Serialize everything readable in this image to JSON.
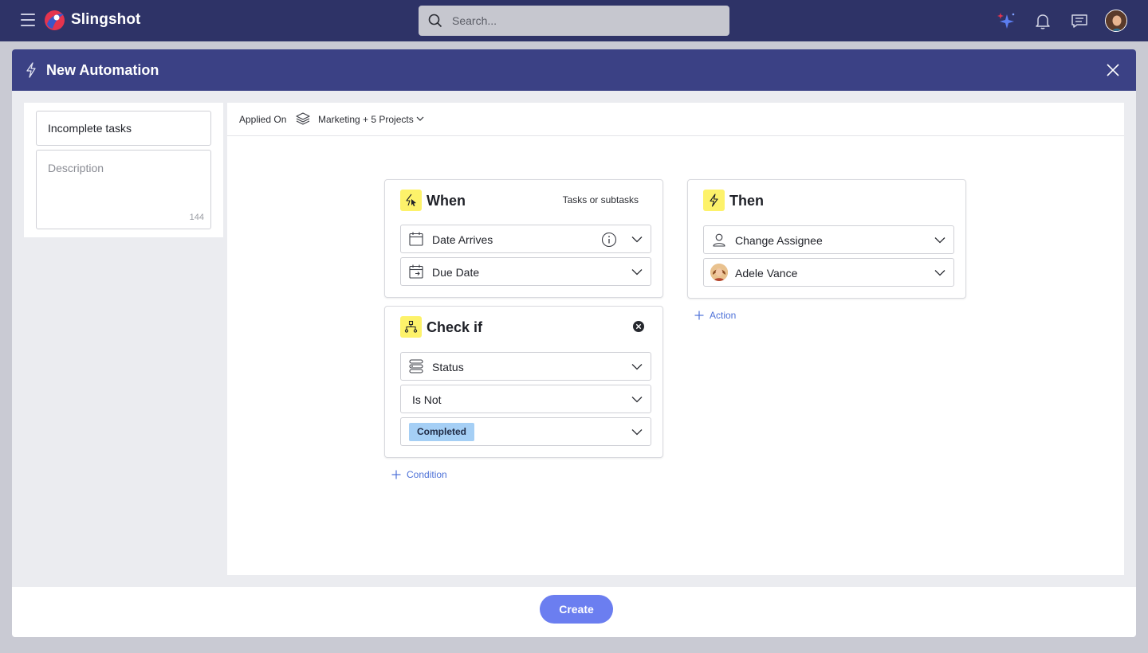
{
  "topbar": {
    "brand": "Slingshot",
    "search_placeholder": "Search...",
    "icons": [
      "menu-icon",
      "sparkle-ai-icon",
      "bell-icon",
      "chat-icon",
      "user-avatar"
    ]
  },
  "modal": {
    "title": "New Automation",
    "name_value": "Incomplete tasks",
    "description_placeholder": "Description",
    "description_char_count": "144",
    "applied_on_label": "Applied On",
    "applied_on_value": "Marketing + 5 Projects",
    "when": {
      "title": "When",
      "scope": "Tasks or subtasks",
      "trigger": "Date Arrives",
      "date_field": "Due Date"
    },
    "check_if": {
      "title": "Check if",
      "field": "Status",
      "operator": "Is Not",
      "value": "Completed"
    },
    "add_condition": "Condition",
    "then": {
      "title": "Then",
      "action": "Change Assignee",
      "assignee": "Adele Vance"
    },
    "add_action": "Action",
    "create_label": "Create"
  },
  "colors": {
    "topbar": "#2e3367",
    "modal_header": "#3b4185",
    "badge_yellow": "#fdf26a",
    "chip_blue": "#a5cff5",
    "primary_button": "#6b7ef0",
    "link_blue": "#4e72d8"
  }
}
